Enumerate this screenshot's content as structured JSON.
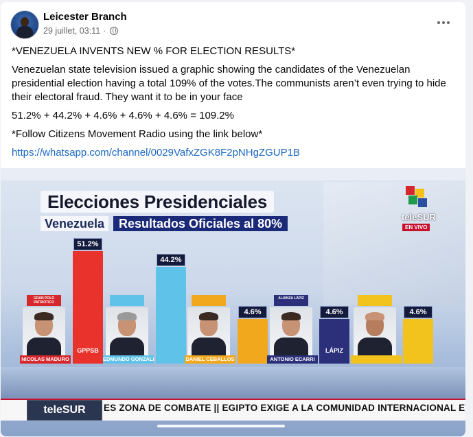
{
  "post": {
    "author": "Leicester Branch",
    "timestamp": "29 juillet, 03:11",
    "more_icon": "more-horizontal-icon",
    "privacy_icon": "globe-icon",
    "headline": "*VENEZUELA INVENTS NEW % FOR ELECTION RESULTS*",
    "body": "Venezuelan state television issued a graphic showing the candidates of the Venezuelan presidential election having a total 109% of the votes.The communists aren’t even trying to hide their electoral fraud. They want it to be in your face",
    "equation": "51.2% + 44.2% + 4.6% + 4.6% + 4.6% = 109.2%",
    "follow": "*Follow Citizens Movement Radio using the link below*",
    "link": "https://whatsapp.com/channel/0029VafxZGK8F2pNHgZGUP1B"
  },
  "image": {
    "title": "Elecciones Presidenciales",
    "subtitle_country": "Venezuela",
    "subtitle_results": "Resultados Oficiales al 80%",
    "broadcaster": "teleSUR",
    "live_label": "EN VIVO",
    "ticker_logo": "teleSUR",
    "ticker_text": "ES ZONA DE COMBATE  ||  EGIPTO EXIGE A LA COMUNIDAD INTERNACIONAL EVITAR",
    "candidates": [
      {
        "name": "NICOLAS MADURO",
        "party": "GRAN POLO PATRIÓTICO",
        "pct_label": "51.2%",
        "value": 51.2,
        "bar_logo": "GPPSB",
        "color": "#e8322b"
      },
      {
        "name": "EDMUNDO GONZÁLEZ",
        "party": "",
        "pct_label": "44.2%",
        "value": 44.2,
        "bar_logo": "",
        "color": "#5fc2e8"
      },
      {
        "name": "DANIEL CEBALLOS",
        "party": "",
        "pct_label": "4.6%",
        "value": 4.6,
        "bar_logo": "",
        "color": "#f2a81d"
      },
      {
        "name": "ANTONIO ECARRI",
        "party": "ALIANZA LÁPIZ",
        "pct_label": "4.6%",
        "value": 4.6,
        "bar_logo": "LÁPIZ",
        "color": "#2c2f7a"
      },
      {
        "name": "",
        "party": "",
        "pct_label": "4.6%",
        "value": 4.6,
        "bar_logo": "",
        "color": "#f2c21d"
      }
    ]
  },
  "chart_data": {
    "type": "bar",
    "title": "Elecciones Presidenciales",
    "subtitle": "Resultados Oficiales al 80%",
    "categories": [
      "NICOLAS MADURO",
      "EDMUNDO GONZÁLEZ",
      "DANIEL CEBALLOS",
      "ANTONIO ECARRI",
      ""
    ],
    "values": [
      51.2,
      44.2,
      4.6,
      4.6,
      4.6
    ],
    "data_labels": [
      "51.2%",
      "44.2%",
      "4.6%",
      "4.6%",
      "4.6%"
    ]
  }
}
